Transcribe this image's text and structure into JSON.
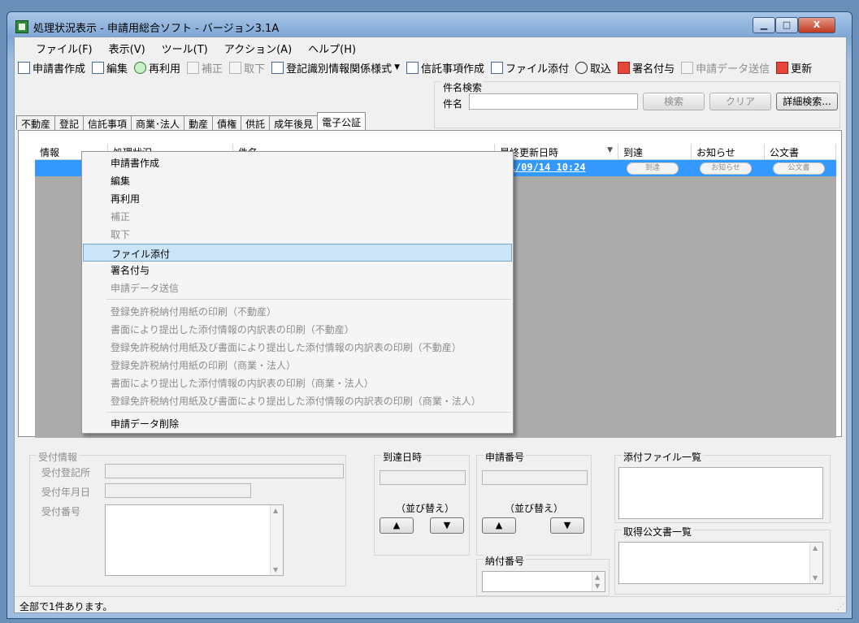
{
  "window": {
    "title": "処理状況表示 - 申請用総合ソフト - バージョン3.1A",
    "min": "▁",
    "max": "□",
    "close": "X"
  },
  "menu": [
    "ファイル(F)",
    "表示(V)",
    "ツール(T)",
    "アクション(A)",
    "ヘルプ(H)"
  ],
  "toolbar": {
    "create": "申請書作成",
    "edit": "編集",
    "reuse": "再利用",
    "correct": "補正",
    "withdraw": "取下",
    "register_info": "登記識別情報関係様式",
    "trust": "信託事項作成",
    "attach": "ファイル添付",
    "fetch": "取込",
    "sign": "署名付与",
    "send": "申請データ送信",
    "refresh": "更新"
  },
  "search": {
    "group_title": "件名検索",
    "label": "件名",
    "value": "",
    "search_btn": "検索",
    "clear_btn": "クリア",
    "advanced_btn": "詳細検索..."
  },
  "tabs": [
    "不動産",
    "登記",
    "信託事項",
    "商業･法人",
    "動産",
    "債権",
    "供託",
    "成年後見",
    "電子公証"
  ],
  "columns": [
    "情報",
    "処理状況",
    "件名",
    "最終更新日時",
    "到達",
    "お知らせ",
    "公文書"
  ],
  "row": {
    "date": "2011/09/14 10:24",
    "arrival": "到達",
    "notice": "お知らせ",
    "official": "公文書"
  },
  "context_menu": {
    "items": [
      "申請書作成",
      "編集",
      "再利用",
      "補正",
      "取下",
      "ファイル添付",
      "署名付与",
      "申請データ送信"
    ],
    "print_items": [
      "登録免許税納付用紙の印刷（不動産）",
      "書面により提出した添付情報の内訳表の印刷（不動産）",
      "登録免許税納付用紙及び書面により提出した添付情報の内訳表の印刷（不動産）",
      "登録免許税納付用紙の印刷（商業・法人）",
      "書面により提出した添付情報の内訳表の印刷（商業・法人）",
      "登録免許税納付用紙及び書面により提出した添付情報の内訳表の印刷（商業・法人）"
    ],
    "delete": "申請データ削除"
  },
  "bottom": {
    "receipt_title": "受付情報",
    "receipt_office": "受付登記所",
    "receipt_date": "受付年月日",
    "receipt_no": "受付番号",
    "arrival_title": "到達日時",
    "app_no_title": "申請番号",
    "sort_label": "（並び替え）",
    "up": "▲",
    "down": "▼",
    "payment_title": "納付番号",
    "attach_list": "添付ファイル一覧",
    "docs_list": "取得公文書一覧"
  },
  "status": "全部で1件あります。"
}
